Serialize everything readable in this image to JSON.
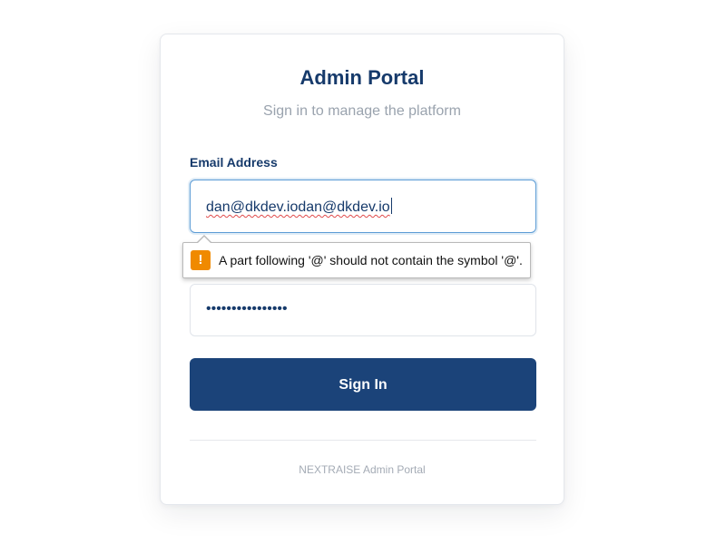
{
  "header": {
    "title": "Admin Portal",
    "subtitle": "Sign in to manage the platform"
  },
  "form": {
    "email_label": "Email Address",
    "email_value": "dan@dkdev.iodan@dkdev.io",
    "validation_message": "A part following '@' should not contain the symbol '@'.",
    "validation_icon": "warning-icon",
    "password_value": "••••••••••••••••",
    "submit_label": "Sign In"
  },
  "footer": {
    "text": "NEXTRAISE Admin Portal"
  },
  "colors": {
    "brand": "#163a6b",
    "button": "#1b4379",
    "focus_border": "#5b9bd5",
    "warning": "#f08a00"
  }
}
